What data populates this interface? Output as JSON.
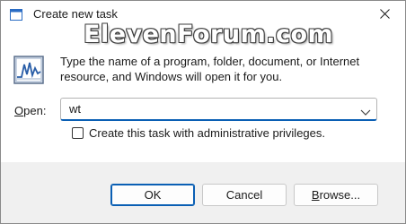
{
  "titlebar": {
    "title": "Create new task",
    "icon": "run-dialog-icon",
    "close_icon": "close-icon"
  },
  "watermark": "ElevenForum.com",
  "app_icon": "task-manager-icon",
  "description": "Type the name of a program, folder, document, or Internet resource, and Windows will open it for you.",
  "open_field": {
    "label_accel": "O",
    "label_rest": "pen:",
    "value": "wt",
    "dropdown_icon": "chevron-down-icon"
  },
  "admin_checkbox": {
    "label": "Create this task with administrative privileges.",
    "checked": false
  },
  "buttons": {
    "ok": "OK",
    "cancel": "Cancel",
    "browse_accel": "B",
    "browse_rest": "rowse..."
  },
  "colors": {
    "accent": "#0a5fb4",
    "footer_bg": "#f0f0f0"
  }
}
